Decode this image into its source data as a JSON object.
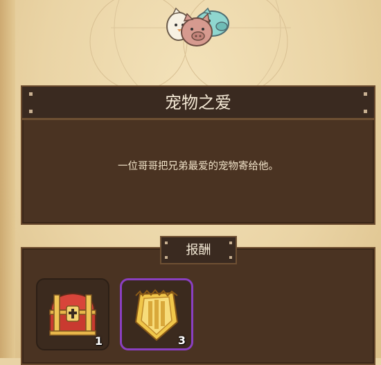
{
  "quest": {
    "title": "宠物之爱",
    "description": "一位哥哥把兄弟最爱的宠物寄给他。"
  },
  "rewards": {
    "label": "报酬",
    "items": [
      {
        "icon": "treasure-chest-icon",
        "count": "1",
        "frame_color": "#2c1f16"
      },
      {
        "icon": "golden-shield-icon",
        "count": "3",
        "frame_color": "#8a3fc1"
      }
    ]
  },
  "header": {
    "icon": "pets-group-icon"
  }
}
